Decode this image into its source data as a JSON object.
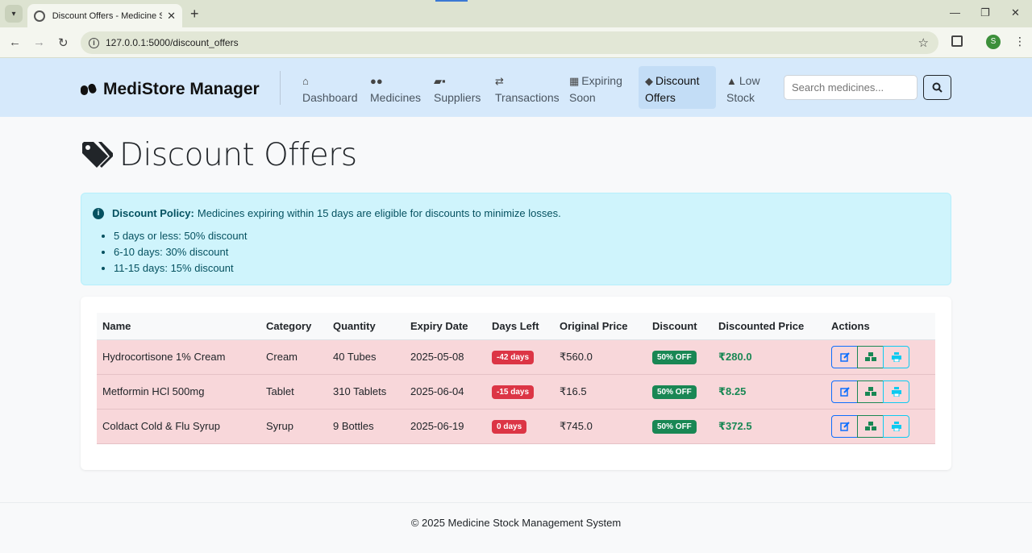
{
  "browser": {
    "tab_title": "Discount Offers - Medicine Stock",
    "url": "127.0.0.1:5000/discount_offers",
    "profile_initial": "S"
  },
  "nav": {
    "brand": "MediStore Manager",
    "items": [
      {
        "label": "Dashboard",
        "icon": "home-icon",
        "active": false
      },
      {
        "label": "Medicines",
        "icon": "capsules-icon",
        "active": false
      },
      {
        "label": "Suppliers",
        "icon": "truck-icon",
        "active": false
      },
      {
        "label": "Transactions",
        "icon": "exchange-icon",
        "active": false
      },
      {
        "label": "Expiring Soon",
        "icon": "calendar-icon",
        "active": false
      },
      {
        "label": "Discount Offers",
        "icon": "tags-icon",
        "active": true
      },
      {
        "label": "Low Stock",
        "icon": "warning-icon",
        "active": false
      }
    ],
    "search_placeholder": "Search medicines..."
  },
  "page": {
    "title": "Discount Offers"
  },
  "alert": {
    "label": "Discount Policy:",
    "text": "Medicines expiring within 15 days are eligible for discounts to minimize losses.",
    "rules": [
      "5 days or less: 50% discount",
      "6-10 days: 30% discount",
      "11-15 days: 15% discount"
    ]
  },
  "table": {
    "headers": [
      "Name",
      "Category",
      "Quantity",
      "Expiry Date",
      "Days Left",
      "Original Price",
      "Discount",
      "Discounted Price",
      "Actions"
    ],
    "rows": [
      {
        "name": "Hydrocortisone 1% Cream",
        "category": "Cream",
        "quantity": "40 Tubes",
        "expiry": "2025-05-08",
        "days_left": "-42 days",
        "original_price": "₹560.0",
        "discount": "50% OFF",
        "discounted_price": "₹280.0"
      },
      {
        "name": "Metformin HCl 500mg",
        "category": "Tablet",
        "quantity": "310 Tablets",
        "expiry": "2025-06-04",
        "days_left": "-15 days",
        "original_price": "₹16.5",
        "discount": "50% OFF",
        "discounted_price": "₹8.25"
      },
      {
        "name": "Coldact Cold & Flu Syrup",
        "category": "Syrup",
        "quantity": "9 Bottles",
        "expiry": "2025-06-19",
        "days_left": "0 days",
        "original_price": "₹745.0",
        "discount": "50% OFF",
        "discounted_price": "₹372.5"
      }
    ]
  },
  "footer": {
    "text": "© 2025 Medicine Stock Management System"
  },
  "colors": {
    "navbar_bg": "#d6e9fb",
    "row_danger_bg": "#f8d7da",
    "badge_danger": "#dc3545",
    "badge_success": "#198754",
    "alert_bg": "#cff4fc"
  }
}
